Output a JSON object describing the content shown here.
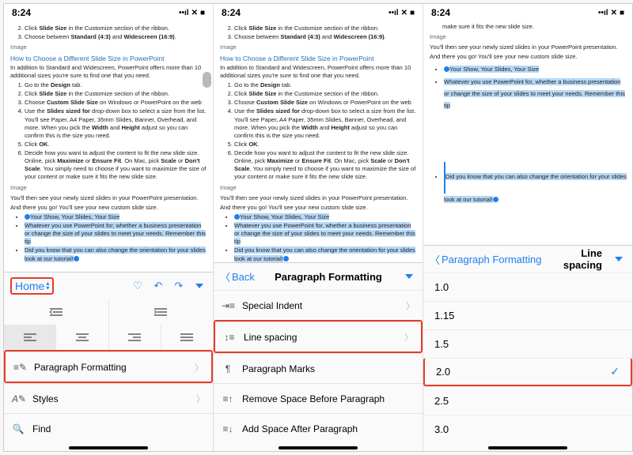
{
  "status": {
    "time": "8:24",
    "signal": "••ıl",
    "wifi": "▰",
    "battery": "▮▮"
  },
  "doc": {
    "steps1": [
      "Click <b>Slide Size</b> in the Customize section of the ribbon.",
      "Choose between <b>Standard (4:3)</b> and <b>Widescreen (16:9)</b>."
    ],
    "imgLabel": "Image",
    "h2": "How to Choose a Different Slide Size in PowerPoint",
    "intro": "In addition to Standard and Widescreen, PowerPoint offers more than 10 additional sizes you're sure to find one that you need.",
    "steps2_short": [
      "Go to the <b>Design</b> tab.",
      "Click <b>Slide Size</b> in the Customize section of the ribbon.",
      "Choose <b>Custom Slide Size</b> on Windows or PowerPoint on the web",
      "Use the <b>Slides sized for</b> drop-down box to select a size from the list. You'll see Paper, A4 Paper, 35mm Slides, Banner, Overhead, and more. When you pick the <b>Width</b> and <b>Height</b> adjust so you can confirm this is the size you need.",
      "Click <b>OK</b>.",
      "Decide how you want to adjust the content to fit the new slide size. Online, pick <b>Maximize</b> or <b>Ensure Fit</b>. On Mac, pick <b>Scale</b> or <b>Don't Scale</b>. You simply need to choose if you want to maximize the size of your content or make sure it fits the new slide size."
    ],
    "after": "You'll then see your newly sized slides in your PowerPoint presentation.",
    "custom": "And there you go! You'll see your new custom slide size.",
    "bul1": "Your Show, Your Slides, Your Size",
    "bul2": "Whatever you use PowerPoint for, whether a business presentation or change the size of your slides to meet your needs. Remember this tip",
    "bul3": "Did you know that you can also change the orientation for your slides look at our tutorial!"
  },
  "pane1": {
    "home": "Home",
    "menu": {
      "pf": "Paragraph Formatting",
      "styles": "Styles",
      "find": "Find"
    }
  },
  "pane2": {
    "back": "Back",
    "title": "Paragraph Formatting",
    "items": {
      "si": "Special Indent",
      "ls": "Line spacing",
      "pm": "Paragraph Marks",
      "rsb": "Remove Space Before Paragraph",
      "asa": "Add Space After Paragraph"
    }
  },
  "pane3": {
    "title": "Paragraph Formatting",
    "sub": "Line spacing",
    "vals": [
      "1.0",
      "1.15",
      "1.5",
      "2.0",
      "2.5",
      "3.0"
    ],
    "selected": "2.0"
  }
}
